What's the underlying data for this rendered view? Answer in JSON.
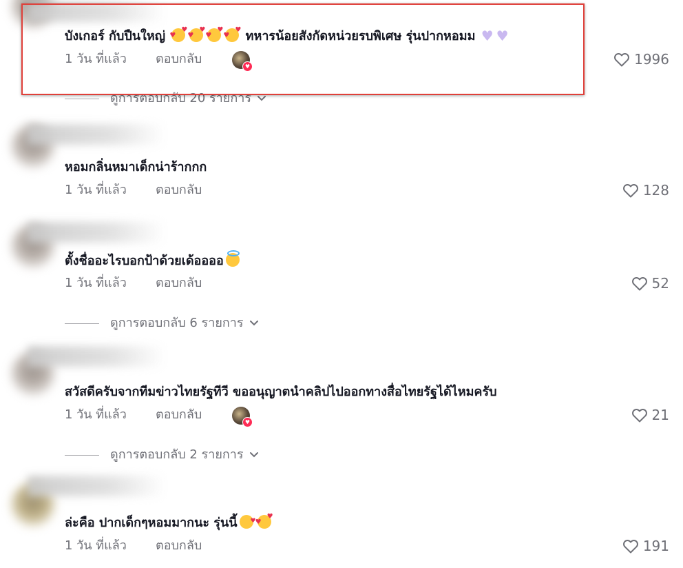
{
  "comments": [
    {
      "text": "บังเกอร์ กับปืนใหญ่ ",
      "text_after_emoji": "  ทหารน้อยสังกัดหน่วยรบพิเศษ รุ่นปากหอมม ",
      "time": "1 วัน ที่แล้ว",
      "reply": "ตอบกลับ",
      "likes": "1996",
      "creator_liked": true,
      "replies_label": "ดูการตอบกลับ 20 รายการ"
    },
    {
      "text": "หอมกลิ่นหมาเด็กน่าร้ากกก",
      "time": "1 วัน ที่แล้ว",
      "reply": "ตอบกลับ",
      "likes": "128"
    },
    {
      "text": "ตั้งชื่ออะไรบอกป้าด้วยเด้ออออ",
      "time": "1 วัน ที่แล้ว",
      "reply": "ตอบกลับ",
      "likes": "52",
      "replies_label": "ดูการตอบกลับ 6 รายการ"
    },
    {
      "text": "สวัสดีครับจากทีมข่าวไทยรัฐทีวี ขออนุญาตนำคลิปไปออกทางสื่อไทยรัฐได้ไหมครับ",
      "time": "1 วัน ที่แล้ว",
      "reply": "ตอบกลับ",
      "likes": "21",
      "creator_liked": true,
      "replies_label": "ดูการตอบกลับ 2 รายการ"
    },
    {
      "text": "ล่ะคือ ปากเด็กๆหอมมากนะ รุ่นนี้",
      "time": "1 วัน ที่แล้ว",
      "reply": "ตอบกลับ",
      "likes": "191"
    }
  ],
  "icons": {
    "like": "heart-outline-icon",
    "replies_toggle": "chevron-down-icon",
    "creator_badge": "heart-badge-icon"
  },
  "colors": {
    "highlight_border": "#e0403a",
    "text_primary": "#161823",
    "text_secondary": "#6f7077",
    "creator_heart": "#fe2c55"
  }
}
